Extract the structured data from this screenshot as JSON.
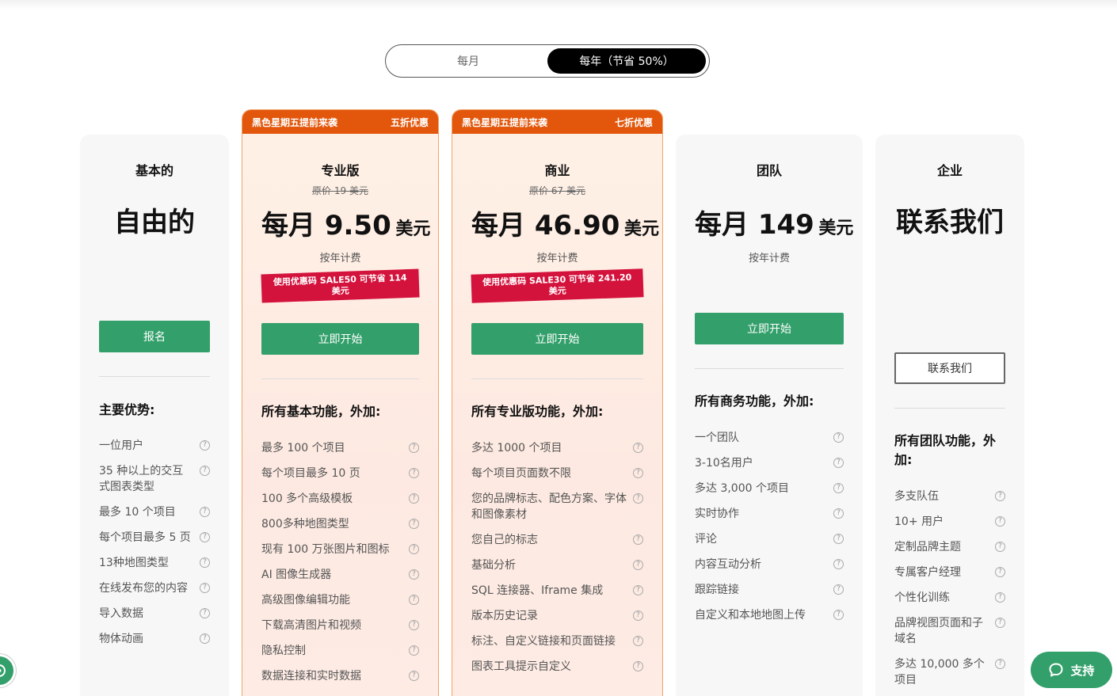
{
  "billing_toggle": {
    "monthly": "每月",
    "yearly": "每年（节省 50%）"
  },
  "plans": {
    "basic": {
      "name": "基本的",
      "price": "自由的",
      "button": "报名",
      "features_title": "主要优势:",
      "features": [
        "一位用户",
        "35 种以上的交互式图表类型",
        "最多 10 个项目",
        "每个项目最多 5 页",
        "13种地图类型",
        "在线发布您的内容",
        "导入数据",
        "物体动画"
      ]
    },
    "pro": {
      "banner_left": "黑色星期五提前来袭",
      "banner_right": "五折优惠",
      "name": "专业版",
      "original_price": "原价 19 美元",
      "price_amount": "每月 9.50",
      "price_currency": "美元",
      "billing": "按年计费",
      "coupon": "使用优惠码 SALE50 可节省 114 美元",
      "button": "立即开始",
      "features_title": "所有基本功能，外加:",
      "features": [
        "最多 100 个项目",
        "每个项目最多 10 页",
        "100 多个高级模板",
        "800多种地图类型",
        "现有 100 万张图片和图标",
        "AI 图像生成器",
        "高级图像编辑功能",
        "下载高清图片和视频",
        "隐私控制",
        "数据连接和实时数据"
      ]
    },
    "business": {
      "banner_left": "黑色星期五提前来袭",
      "banner_right": "七折优惠",
      "name": "商业",
      "original_price": "原价 67 美元",
      "price_amount": "每月 46.90",
      "price_currency": "美元",
      "billing": "按年计费",
      "coupon": "使用优惠码 SALE30 可节省 241.20 美元",
      "button": "立即开始",
      "features_title": "所有专业版功能，外加:",
      "features": [
        "多达 1000 个项目",
        "每个项目页面数不限",
        "您的品牌标志、配色方案、字体和图像素材",
        "您自己的标志",
        "基础分析",
        "SQL 连接器、Iframe 集成",
        "版本历史记录",
        "标注、自定义链接和页面链接",
        "图表工具提示自定义"
      ]
    },
    "team": {
      "name": "团队",
      "price_amount": "每月 149",
      "price_currency": "美元",
      "billing": "按年计费",
      "button": "立即开始",
      "features_title": "所有商务功能，外加:",
      "features": [
        "一个团队",
        "3-10名用户",
        "多达 3,000 个项目",
        "实时协作",
        "评论",
        "内容互动分析",
        "跟踪链接",
        "自定义和本地地图上传"
      ]
    },
    "enterprise": {
      "name": "企业",
      "price": "联系我们",
      "button": "联系我们",
      "features_title": "所有团队功能，外加:",
      "features": [
        "多支队伍",
        "10+ 用户",
        "定制品牌主题",
        "专属客户经理",
        "个性化训练",
        "品牌视图页面和子域名",
        "多达 10,000 多个项目"
      ]
    }
  },
  "support_widget": {
    "label": "支持",
    "icon": "chat-bubble-icon"
  },
  "help_icon_glyph": "?",
  "colors": {
    "accent_green": "#33a06b",
    "banner_orange": "#e2570c",
    "coupon_red": "#d4133d"
  }
}
